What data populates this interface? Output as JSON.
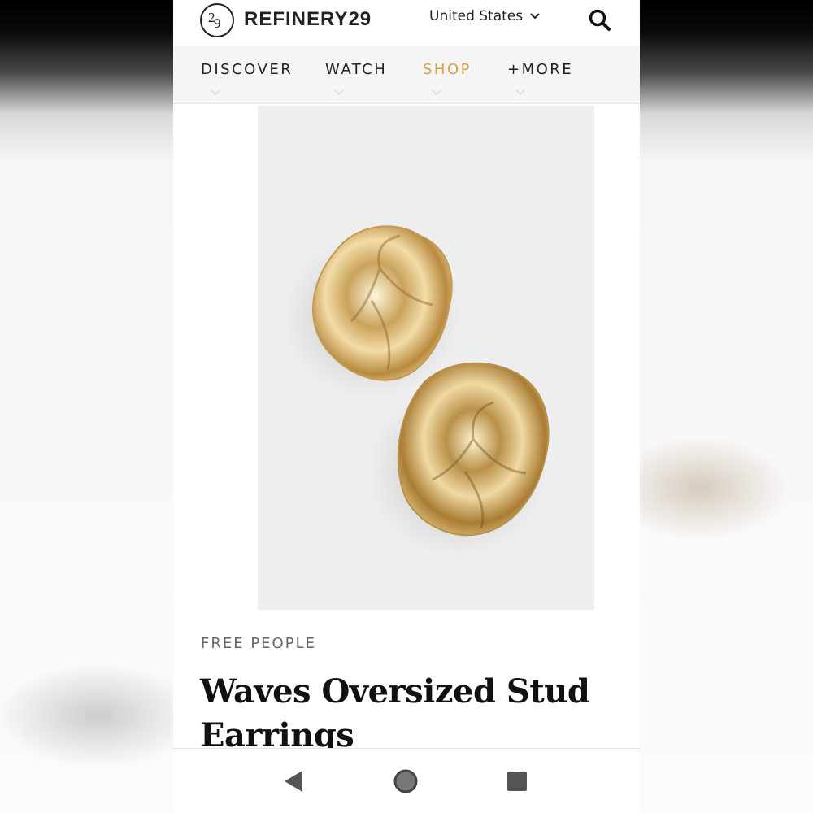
{
  "header": {
    "logo_text": "REFINERY29",
    "logo_mark": "29",
    "region": "United States"
  },
  "nav": {
    "items": [
      {
        "label": "DISCOVER",
        "active": false
      },
      {
        "label": "WATCH",
        "active": false
      },
      {
        "label": "SHOP",
        "active": true
      },
      {
        "label": "+MORE",
        "active": false
      }
    ],
    "active_color": "#d4a24a"
  },
  "product": {
    "brand": "FREE PEOPLE",
    "title": "Waves Oversized Stud Earrings",
    "image_alt": "gold wavy stud earrings"
  },
  "system_nav": {
    "icons": [
      "back-icon",
      "home-icon",
      "recents-icon"
    ]
  }
}
